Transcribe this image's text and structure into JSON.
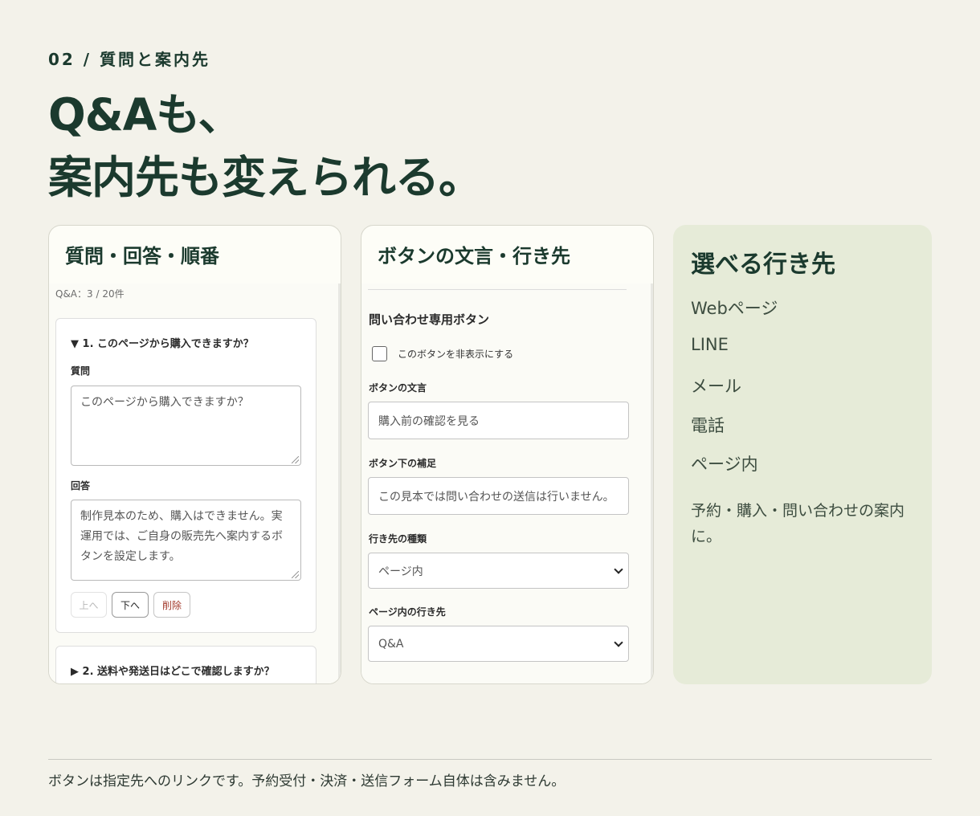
{
  "eyebrow": "02 / 質問と案内先",
  "headline": {
    "line1": "Q&Aも、",
    "line2": "案内先も変えられる。"
  },
  "panel_qa": {
    "title": "質問・回答・順番",
    "count": "Q&A：3 / 20件",
    "item1": {
      "summary": "▼ 1. このページから購入できますか？",
      "question_label": "質問",
      "question_value": "このページから購入できますか？",
      "answer_label": "回答",
      "answer_value": "制作見本のため、購入はできません。実運用では、ご自身の販売先へ案内するボタンを設定します。",
      "up_label": "上へ",
      "down_label": "下へ",
      "delete_label": "削除"
    },
    "item2": {
      "summary": "▶ 2. 送料や発送日はどこで確認しますか？"
    }
  },
  "panel_button": {
    "title": "ボタンの文言・行き先",
    "section_title": "問い合わせ専用ボタン",
    "hide_checkbox_label": "このボタンを非表示にする",
    "text_label": "ボタンの文言",
    "text_value": "購入前の確認を見る",
    "sub_label": "ボタン下の補足",
    "sub_value": "この見本では問い合わせの送信は行いません。",
    "type_label": "行き先の種類",
    "type_value": "ページ内",
    "target_label": "ページ内の行き先",
    "target_value": "Q&A"
  },
  "panel_dest": {
    "title": "選べる行き先",
    "items": [
      "Webページ",
      "LINE",
      "メール",
      "電話",
      "ページ内"
    ],
    "note": "予約・購入・問い合わせの案内に。"
  },
  "footer_note": "ボタンは指定先へのリンクです。予約受付・決済・送信フォーム自体は含みません。",
  "colors": {
    "background": "#f3f2ea",
    "heading": "#1b3a2e",
    "dest_panel": "#e6ebd8",
    "delete": "#a33a2c"
  }
}
